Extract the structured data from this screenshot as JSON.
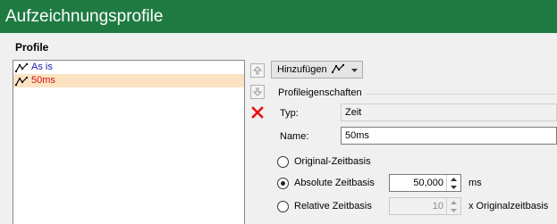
{
  "window": {
    "title": "Aufzeichnungsprofile"
  },
  "profiles": {
    "section_label": "Profile",
    "items": [
      {
        "label": "As is",
        "color": "#1a1aa8",
        "icon": "profile-curve-icon"
      },
      {
        "label": "50ms",
        "color": "#d01010",
        "icon": "profile-curve-icon",
        "selected": true
      }
    ],
    "buttons": {
      "move_up_icon": "arrow-up-icon",
      "move_down_icon": "arrow-down-icon",
      "delete_icon": "red-x-icon"
    }
  },
  "toolbar": {
    "add_label": "Hinzufügen",
    "add_icon": "profile-curve-icon",
    "dropdown_icon": "caret-down-icon"
  },
  "properties": {
    "group_title": "Profileigenschaften",
    "type_label": "Typ:",
    "type_value": "Zeit",
    "name_label": "Name:",
    "name_value": "50ms",
    "timebase_options": [
      {
        "label": "Original-Zeitbasis",
        "checked": false
      },
      {
        "label": "Absolute Zeitbasis",
        "checked": true
      },
      {
        "label": "Relative Zeitbasis",
        "checked": false
      }
    ],
    "absolute_value": "50,000",
    "absolute_unit": "ms",
    "relative_value": "10",
    "relative_unit": "x Originalzeitbasis"
  },
  "colors": {
    "titlebar": "#1f7a42",
    "selection": "#fbe3c2",
    "delete": "#e81010"
  }
}
